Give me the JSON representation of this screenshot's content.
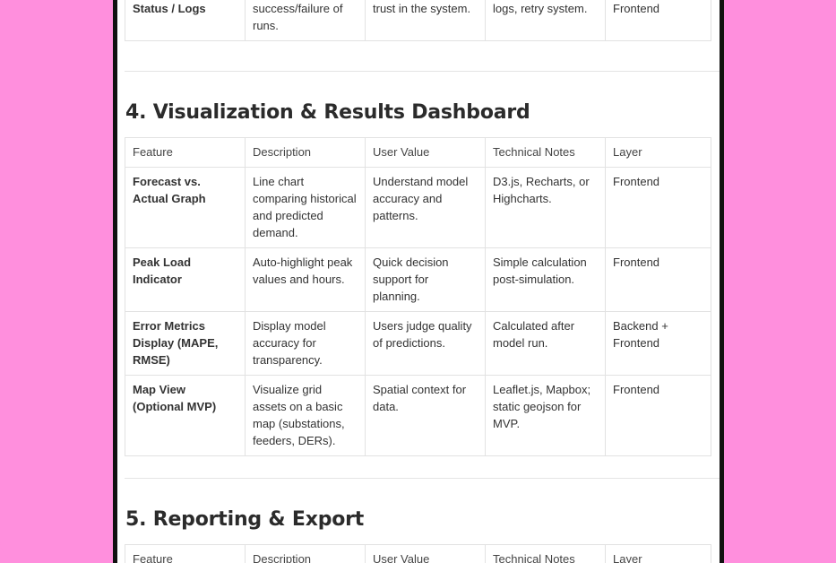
{
  "section3_partial_row": {
    "feature": "Simulation Job Status / Logs",
    "description": "Monitor progress, success/failure of runs.",
    "user_value": "transparency and trust in the system.",
    "technical_notes": "Job ID, timestamp, logs, retry system.",
    "layer": "Backend + Frontend"
  },
  "section4": {
    "title": "4. Visualization & Results Dashboard",
    "headers": [
      "Feature",
      "Description",
      "User Value",
      "Technical Notes",
      "Layer"
    ],
    "rows": [
      {
        "feature": "Forecast vs. Actual Graph",
        "description": "Line chart comparing historical and predicted demand.",
        "user_value": "Understand model accuracy and patterns.",
        "technical_notes": "D3.js, Recharts, or Highcharts.",
        "layer": "Frontend"
      },
      {
        "feature": "Peak Load Indicator",
        "description": "Auto-highlight peak values and hours.",
        "user_value": "Quick decision support for planning.",
        "technical_notes": "Simple calculation post-simulation.",
        "layer": "Frontend"
      },
      {
        "feature": "Error Metrics Display (MAPE, RMSE)",
        "description": "Display model accuracy for transparency.",
        "user_value": "Users judge quality of predictions.",
        "technical_notes": "Calculated after model run.",
        "layer": "Backend + Frontend"
      },
      {
        "feature": "Map View (Optional MVP)",
        "description": "Visualize grid assets on a basic map (substations, feeders, DERs).",
        "user_value": "Spatial context for data.",
        "technical_notes": "Leaflet.js, Mapbox; static geojson for MVP.",
        "layer": "Frontend"
      }
    ]
  },
  "section5": {
    "title": "5. Reporting & Export",
    "headers": [
      "Feature",
      "Description",
      "User Value",
      "Technical Notes",
      "Layer"
    ]
  }
}
